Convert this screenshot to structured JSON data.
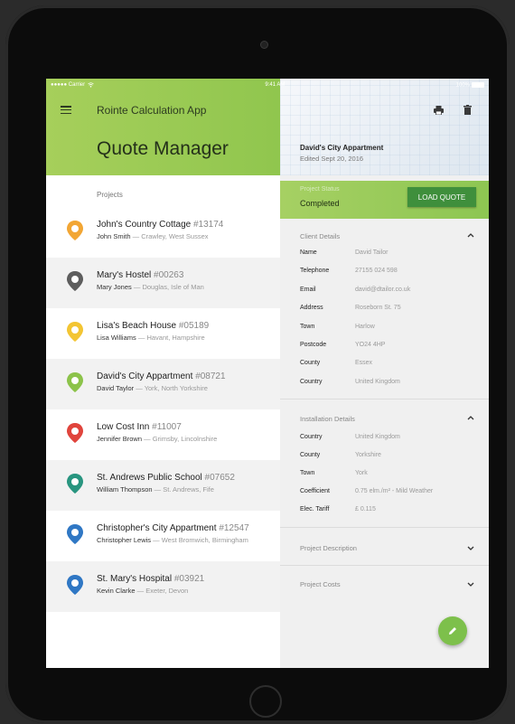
{
  "statusbar": {
    "carrier": "●●●●● Carrier",
    "time": "9:41 AM",
    "battery": "100%"
  },
  "header": {
    "app_title": "Rointe Calculation App",
    "page_title": "Quote Manager"
  },
  "projects": {
    "label": "Projects",
    "items": [
      {
        "name": "John's Country Cottage",
        "number": "#13174",
        "client": "John Smith",
        "location": "Crawley, West Sussex",
        "pin_color": "#f2a634"
      },
      {
        "name": "Mary's Hostel",
        "number": "#00263",
        "client": "Mary Jones",
        "location": "Douglas, Isle of Man",
        "pin_color": "#5d5d5d"
      },
      {
        "name": "Lisa's Beach House",
        "number": "#05189",
        "client": "Lisa Williams",
        "location": "Havant, Hampshire",
        "pin_color": "#f3c533"
      },
      {
        "name": "David's City Appartment",
        "number": "#08721",
        "client": "David Taylor",
        "location": "York, North Yorkshire",
        "pin_color": "#8cc34a"
      },
      {
        "name": "Low Cost Inn",
        "number": "#11007",
        "client": "Jennifer Brown",
        "location": "Grimsby, Lincolnshire",
        "pin_color": "#e0443c"
      },
      {
        "name": "St. Andrews Public School",
        "number": "#07652",
        "client": "William Thompson",
        "location": "St. Andrews, Fife",
        "pin_color": "#28957f"
      },
      {
        "name": "Christopher's City Appartment",
        "number": "#12547",
        "client": "Christopher Lewis",
        "location": "West Bromwich, Birmingham",
        "pin_color": "#2f77c4"
      },
      {
        "name": "St. Mary's Hospital",
        "number": "#03921",
        "client": "Kevin Clarke",
        "location": "Exeter, Devon",
        "pin_color": "#2f77c4"
      }
    ]
  },
  "detail": {
    "title": "David's City Appartment",
    "edited": "Edited Sept 20, 2016",
    "status_label": "Project Status",
    "status_value": "Completed",
    "load_button": "LOAD QUOTE",
    "client_details": {
      "heading": "Client Details",
      "rows": [
        {
          "k": "Name",
          "v": "David Tailor"
        },
        {
          "k": "Telephone",
          "v": "27155 024 598"
        },
        {
          "k": "Email",
          "v": "david@dtailor.co.uk"
        },
        {
          "k": "Address",
          "v": "Roseborn St. 75"
        },
        {
          "k": "Town",
          "v": "Harlow"
        },
        {
          "k": "Postcode",
          "v": "YO24 4HP"
        },
        {
          "k": "County",
          "v": "Essex"
        },
        {
          "k": "Country",
          "v": "United Kingdom"
        }
      ]
    },
    "installation_details": {
      "heading": "Installation Details",
      "rows": [
        {
          "k": "Country",
          "v": "United Kingdom"
        },
        {
          "k": "County",
          "v": "Yorkshire"
        },
        {
          "k": "Town",
          "v": "York"
        },
        {
          "k": "Coefficient",
          "v": "0.75 elm./m² - Mild Weather"
        },
        {
          "k": "Elec. Tariff",
          "v": "£ 0.115"
        }
      ]
    },
    "project_description": "Project Description",
    "project_costs": "Project Costs"
  },
  "colors": {
    "accent_green": "#8dc652",
    "button_green": "#3f8f3c",
    "fab_green": "#7dc04b"
  },
  "icons": [
    "menu-icon",
    "print-icon",
    "trash-icon",
    "chevron-up-icon",
    "chevron-down-icon",
    "pencil-icon",
    "map-pin-icon",
    "wifi-icon",
    "battery-icon"
  ]
}
